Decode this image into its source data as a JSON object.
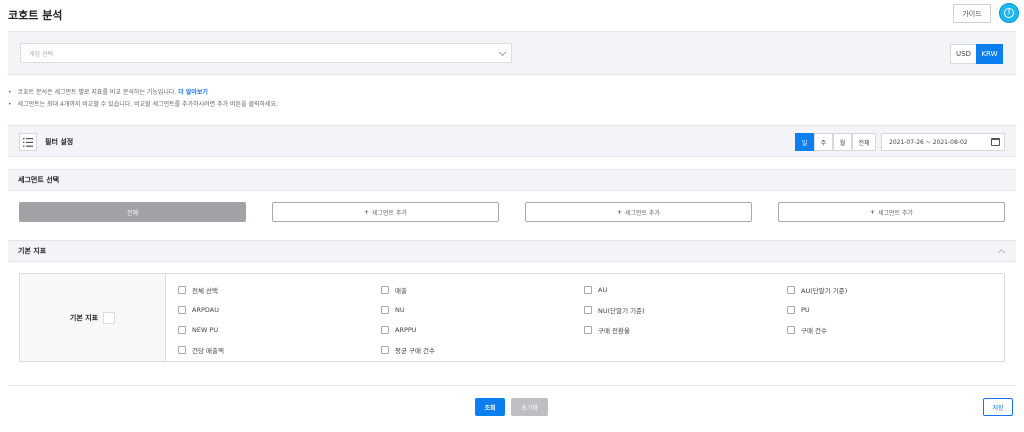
{
  "header": {
    "title": "코호트 분석",
    "guide_label": "가이드",
    "help_icon": "info-circle-icon",
    "help_symbol": "!"
  },
  "game_bar": {
    "select_placeholder": "게임 선택",
    "currency_options": [
      "USD",
      "KRW"
    ],
    "currency_selected": "KRW"
  },
  "notes": [
    {
      "text": "코호트 분석은 세그먼트 별로 지표를 비교 분석하는 기능입니다.",
      "link": "더 알아보기"
    },
    {
      "text": "세그먼트는 최대 4개까지 비교할 수 있습니다. 비교할 세그먼트를 추가하시려면 추가 버튼을 클릭하세요.",
      "link": ""
    }
  ],
  "filter": {
    "title": "필터 설정",
    "period_tabs": [
      "일",
      "주",
      "월",
      "전체"
    ],
    "period_selected": "일",
    "date_range": "2021-07-26 ~ 2021-08-02"
  },
  "segments": {
    "title": "세그먼트 선택",
    "all_label": "전체",
    "add_label": "세그먼트 추가",
    "add_symbol": "+"
  },
  "metrics": {
    "title": "기본 지표",
    "label": "기본 지표",
    "items": [
      "전체 선택",
      "매출",
      "AU",
      "AU(단말기 기준)",
      "ARPDAU",
      "NU",
      "NU(단말기 기준)",
      "PU",
      "NEW PU",
      "ARPPU",
      "구매 전환율",
      "구매 건수",
      "건당 매출액",
      "평균 구매 건수"
    ]
  },
  "actions": {
    "query_label": "조회",
    "reset_label": "초기화",
    "save_label": "저장"
  },
  "colors": {
    "accent": "#0b7ef0",
    "help": "#1bb8f0",
    "panel": "#f3f4f8"
  }
}
